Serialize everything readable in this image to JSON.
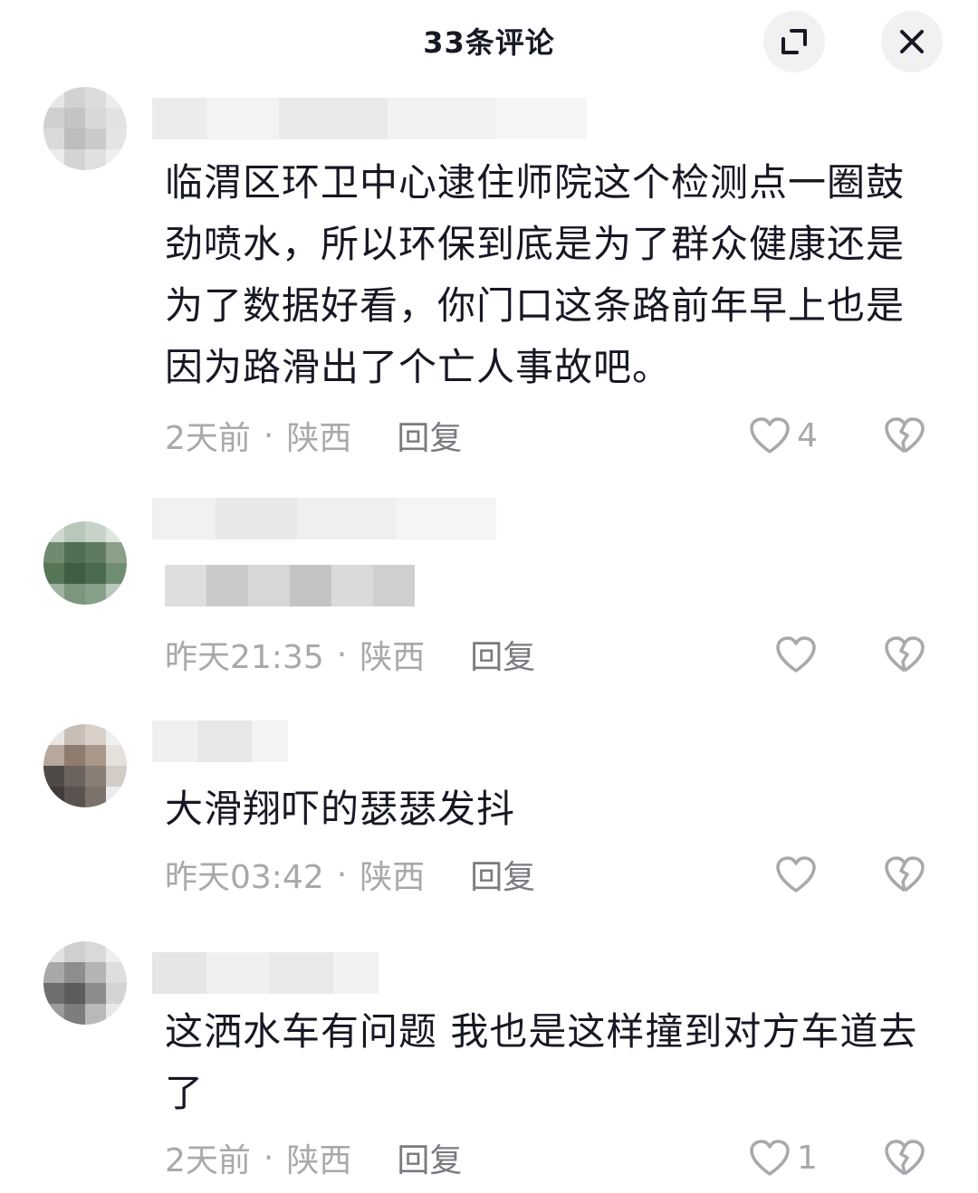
{
  "header": {
    "title": "33条评论",
    "expand_icon": "expand-icon",
    "close_icon": "close-icon"
  },
  "comments": [
    {
      "text": "临渭区环卫中心逮住师院这个检测点一圈鼓劲喷水，所以环保到底是为了群众健康还是为了数据好看，你门口这条路前年早上也是因为路滑出了个亡人事故吧。",
      "time": "2天前",
      "location": "陕西",
      "reply": "回复",
      "likes": "4"
    },
    {
      "text": "",
      "time": "昨天21:35",
      "location": "陕西",
      "reply": "回复",
      "likes": ""
    },
    {
      "text": "大滑翔吓的瑟瑟发抖",
      "time": "昨天03:42",
      "location": "陕西",
      "reply": "回复",
      "likes": ""
    },
    {
      "text": "这洒水车有问题  我也是这样撞到对方车道去了",
      "time": "2天前",
      "location": "陕西",
      "reply": "回复",
      "likes": "1"
    }
  ],
  "separator": "·",
  "colors": {
    "text": "#161823",
    "meta": "#a8a8ad",
    "reply": "#7a7a80",
    "button_bg": "#f1f1f2"
  }
}
